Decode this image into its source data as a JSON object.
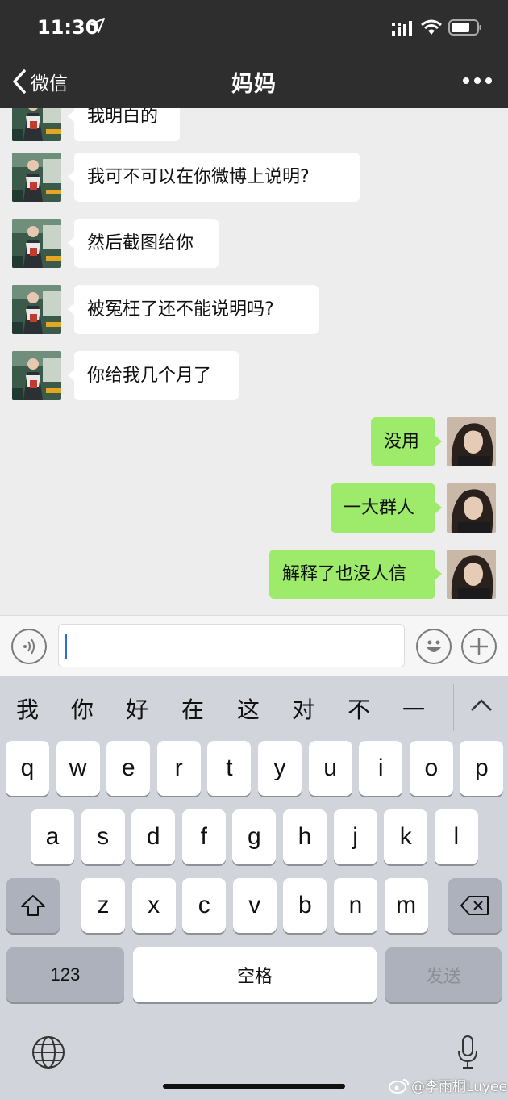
{
  "status_bar": {
    "time": "11:30"
  },
  "nav": {
    "back_label": "微信",
    "title": "妈妈"
  },
  "messages": [
    {
      "side": "left",
      "text": "我明白的"
    },
    {
      "side": "left",
      "text": "我可不可以在你微博上说明?"
    },
    {
      "side": "left",
      "text": "然后截图给你"
    },
    {
      "side": "left",
      "text": "被冤枉了还不能说明吗?"
    },
    {
      "side": "left",
      "text": "你给我几个月了"
    },
    {
      "side": "right",
      "text": "没用"
    },
    {
      "side": "right",
      "text": "一大群人"
    },
    {
      "side": "right",
      "text": "解释了也没人信"
    }
  ],
  "input": {
    "value": ""
  },
  "keyboard": {
    "suggestions": [
      "我",
      "你",
      "好",
      "在",
      "这",
      "对",
      "不",
      "一"
    ],
    "row1": [
      "q",
      "w",
      "e",
      "r",
      "t",
      "y",
      "u",
      "i",
      "o",
      "p"
    ],
    "row2": [
      "a",
      "s",
      "d",
      "f",
      "g",
      "h",
      "j",
      "k",
      "l"
    ],
    "row3": [
      "z",
      "x",
      "c",
      "v",
      "b",
      "n",
      "m"
    ],
    "numbers_label": "123",
    "space_label": "空格",
    "send_label": "发送"
  },
  "watermark": "@李雨桐Luyee",
  "colors": {
    "topbar": "#2e2e2e",
    "chat_bg": "#ededed",
    "bubble_right": "#9eea6a",
    "keyboard_bg": "#d1d4db"
  },
  "icons": [
    "location-arrow-icon",
    "signal-icon",
    "wifi-icon",
    "battery-icon",
    "back-chevron-icon",
    "more-icon",
    "voice-icon",
    "emoji-icon",
    "plus-icon",
    "collapse-chevron-icon",
    "shift-icon",
    "backspace-icon",
    "globe-icon",
    "mic-icon",
    "weibo-icon"
  ]
}
